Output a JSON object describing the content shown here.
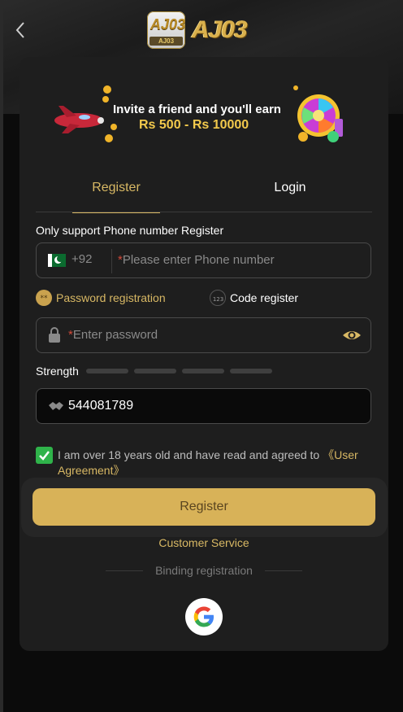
{
  "header": {
    "logo_text": "AJ03",
    "logo_sub": "AJ03"
  },
  "banner": {
    "line1": "Invite a friend and you'll earn",
    "line2": "Rs 500 - Rs 10000"
  },
  "tabs": [
    {
      "label": "Register",
      "active": true
    },
    {
      "label": "Login",
      "active": false
    }
  ],
  "form": {
    "phone_label": "Only support Phone number Register",
    "country_code": "+92",
    "phone_required_mark": "*",
    "phone_placeholder": "Please enter Phone number",
    "options": [
      {
        "label": "Password registration",
        "icon": "password-dots-icon",
        "selected": true
      },
      {
        "label": "Code register",
        "icon": "123-icon",
        "selected": false
      }
    ],
    "password_required_mark": "*",
    "password_placeholder": "Enter password",
    "strength_label": "Strength",
    "invite_code_value": "544081789",
    "agree_text": "I am over 18 years old and have read and agreed to ",
    "agree_link": "《User Agreement》",
    "agree_checked": true,
    "register_button": "Register"
  },
  "footer": {
    "customer_service": "Customer Service",
    "binding_label": "Binding registration",
    "social": [
      {
        "icon": "google-icon"
      }
    ]
  },
  "colors": {
    "accent": "#d8b864",
    "button": "#d8b258",
    "check": "#2fb34a"
  }
}
